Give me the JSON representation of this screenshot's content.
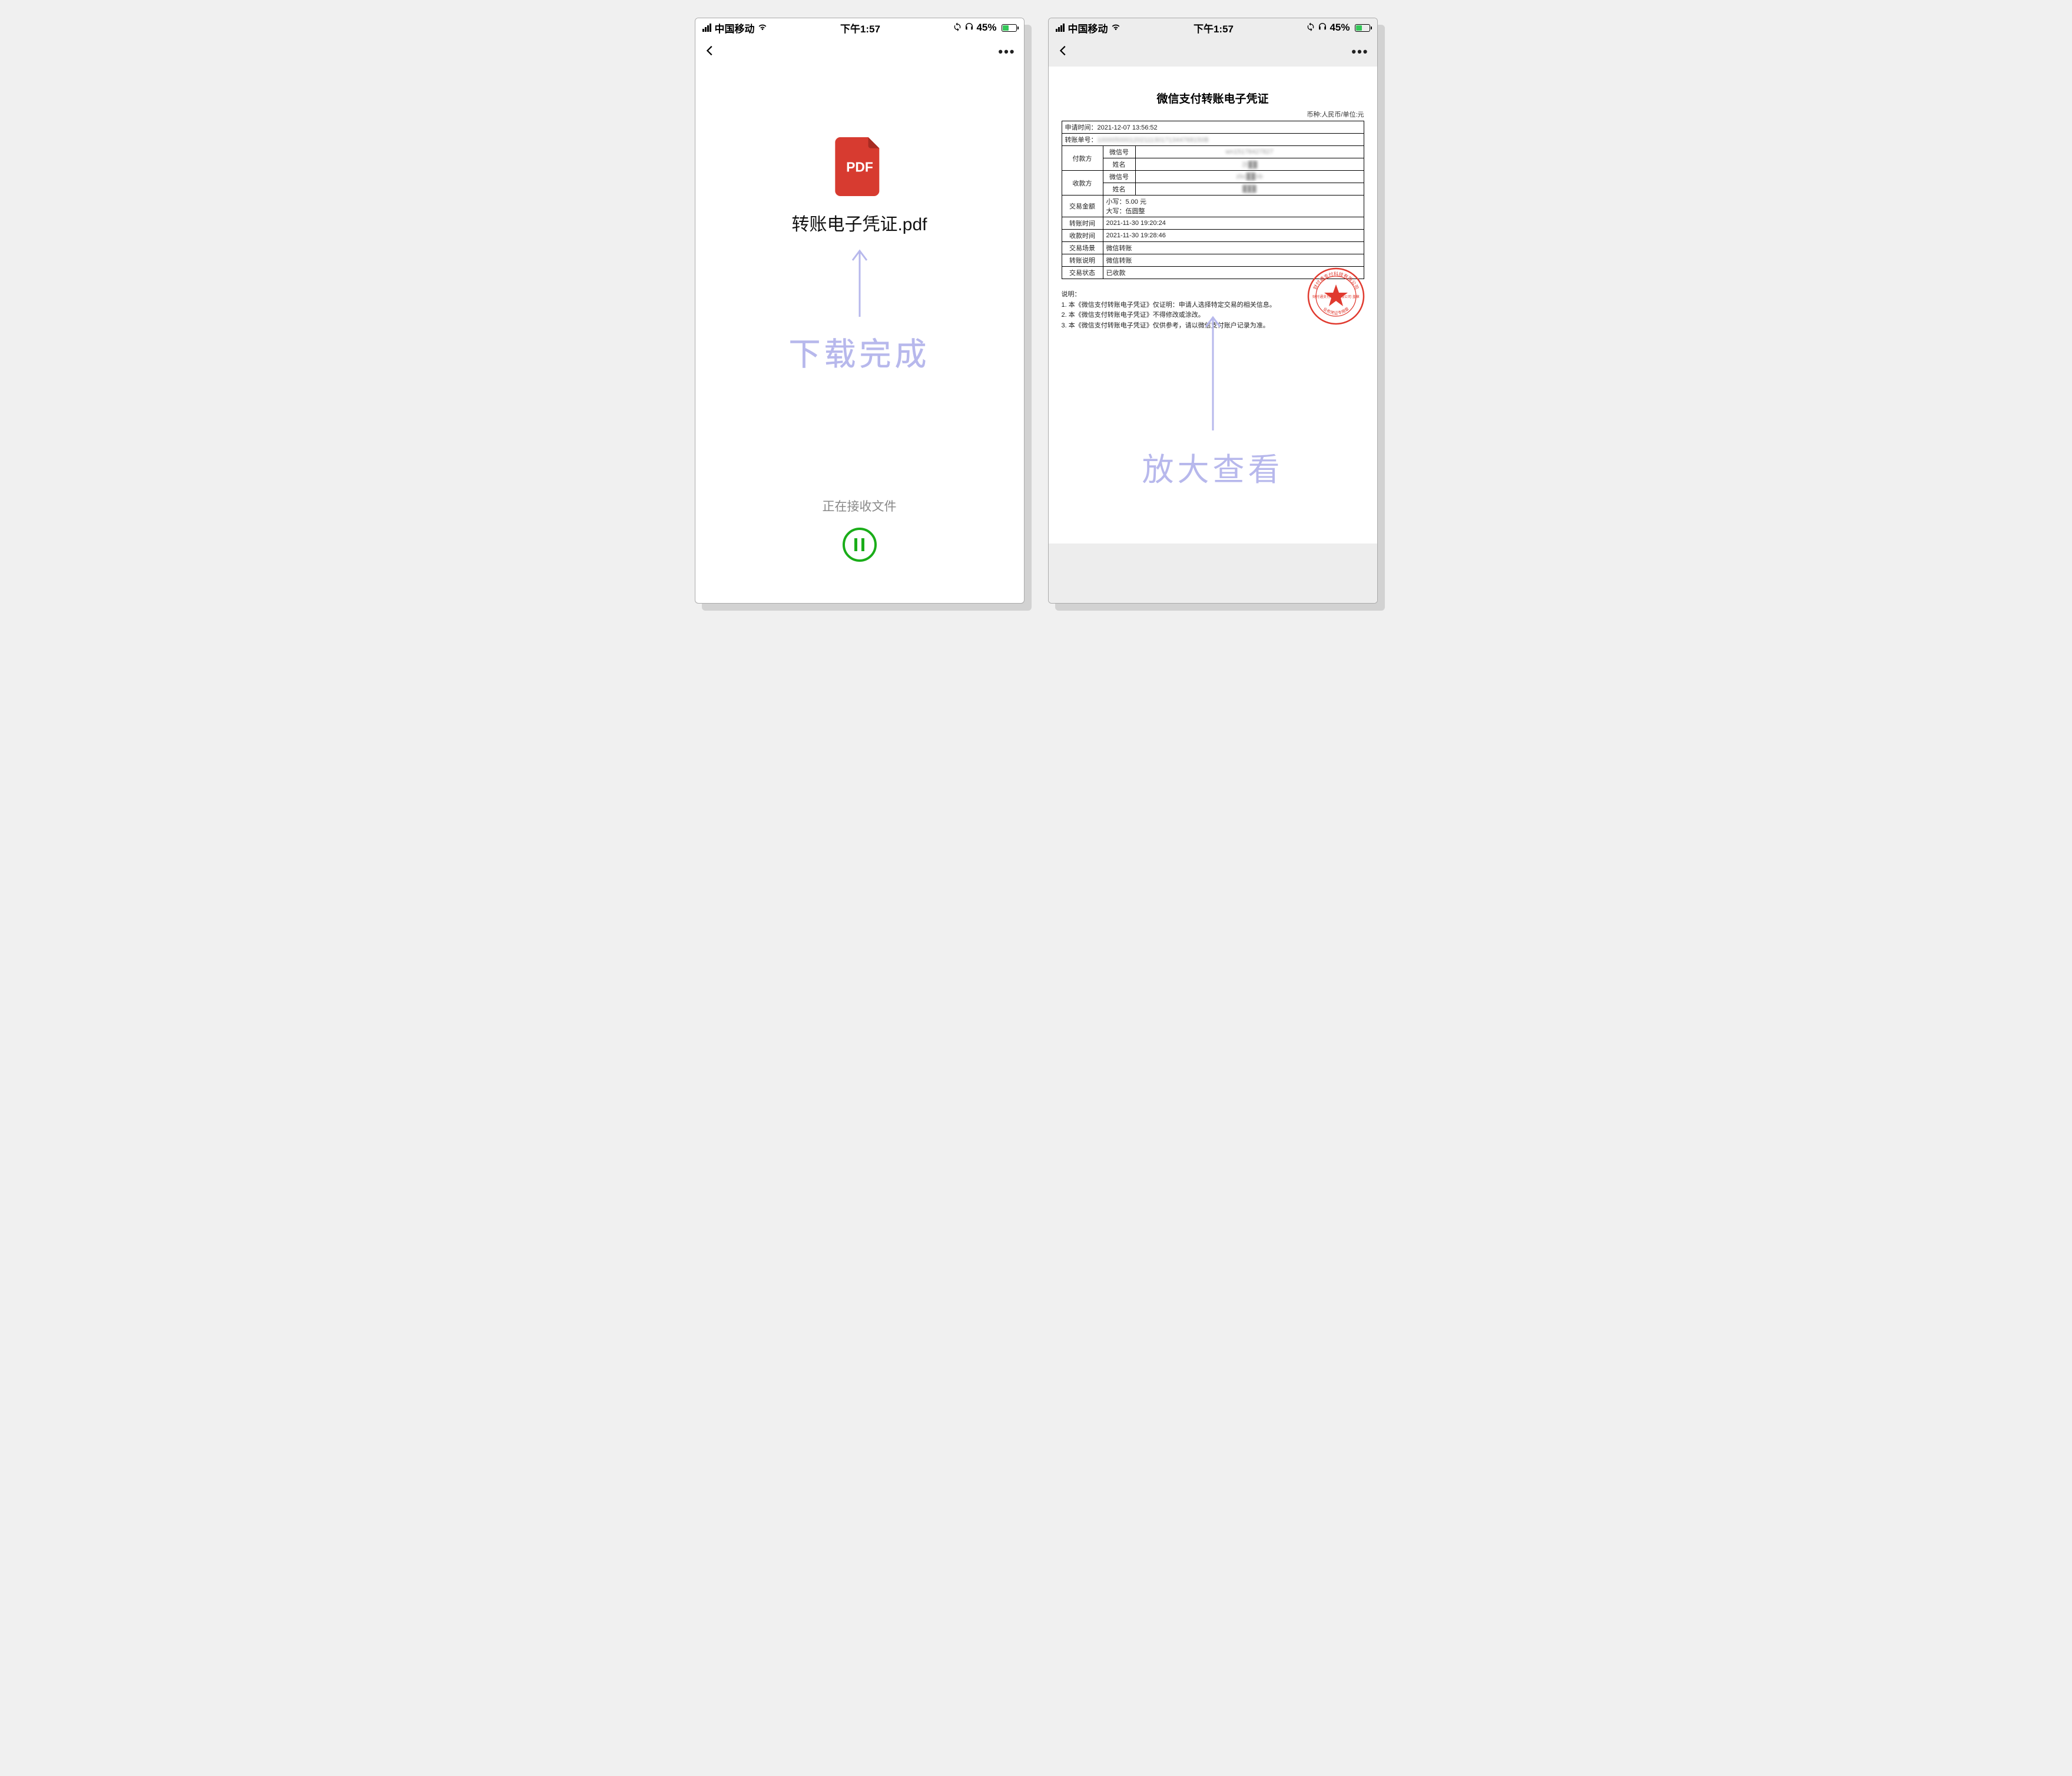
{
  "status": {
    "carrier": "中国移动",
    "time": "下午1:57",
    "battery_pct": "45%"
  },
  "phone1": {
    "file_name": "转账电子凭证.pdf",
    "pdf_badge": "PDF",
    "overlay": "下载完成",
    "receiving": "正在接收文件"
  },
  "phone2": {
    "overlay": "放大查看",
    "doc": {
      "title": "微信支付转账电子凭证",
      "subtitle": "币种:人民币/单位:元",
      "apply_time_label": "申请时间：",
      "apply_time_value": "2021-12-07 13:56:52",
      "order_no_label": "转账单号：",
      "order_no_value": "100005000120211130171344768150B",
      "payer_label": "付款方",
      "payee_label": "收款方",
      "wxid_label": "微信号",
      "name_label": "姓名",
      "payer_wxid": "wn15178427827",
      "payer_name": "沙██",
      "payee_wxid": "zbc██nb",
      "payee_name": "███",
      "amount_label": "交易金额",
      "amount_small_label": "小写：",
      "amount_small_value": "5.00 元",
      "amount_big_label": "大写：",
      "amount_big_value": "伍圆整",
      "transfer_time_label": "转账时间",
      "transfer_time_value": "2021-11-30 19:20:24",
      "receive_time_label": "收款时间",
      "receive_time_value": "2021-11-30 19:28:46",
      "scene_label": "交易场景",
      "scene_value": "微信转账",
      "desc_label": "转账说明",
      "desc_value": "微信转账",
      "state_label": "交易状态",
      "state_value": "已收款",
      "notes_title": "说明：",
      "note1": "1. 本《微信支付转账电子凭证》仅证明：申请人选择特定交易的相关信息。",
      "note2": "2. 本《微信支付转账电子凭证》不得修改或涂改。",
      "note3": "3. 本《微信支付转账电子凭证》仅供参考，请以微信支付账户记录为准。",
      "stamp_outer": "财付通支付科技有限公司",
      "stamp_center": "财付通支付科技有限公司    盖章",
      "stamp_inner": "业务凭证专用章"
    }
  }
}
